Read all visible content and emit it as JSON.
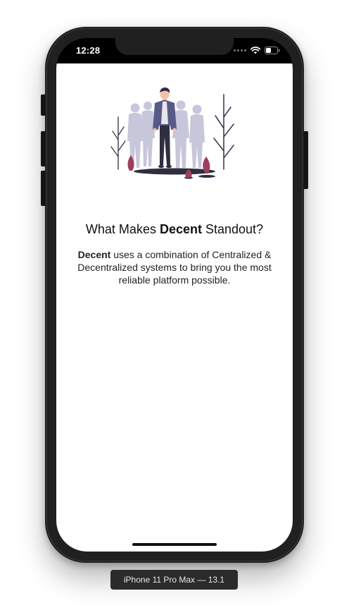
{
  "status_bar": {
    "time": "12:28",
    "icons": [
      "signal-dots-icon",
      "wifi-icon",
      "battery-icon"
    ]
  },
  "onboarding": {
    "illustration": "group-of-people-illustration",
    "headline": {
      "prefix": "What Makes ",
      "emphasis": "Decent",
      "suffix": " Standout?"
    },
    "body": {
      "emphasis": "Decent",
      "text": " uses a combination of Centralized & Decentralized systems to bring you the most reliable platform possible."
    }
  },
  "device_label": "iPhone 11 Pro Max — 13.1",
  "colors": {
    "screen_background": "#ffffff",
    "device_frame": "#202020",
    "jacket_accent": "#575a89",
    "plant_accent": "#9e3e5d",
    "silhouette": "#c8c6db"
  }
}
